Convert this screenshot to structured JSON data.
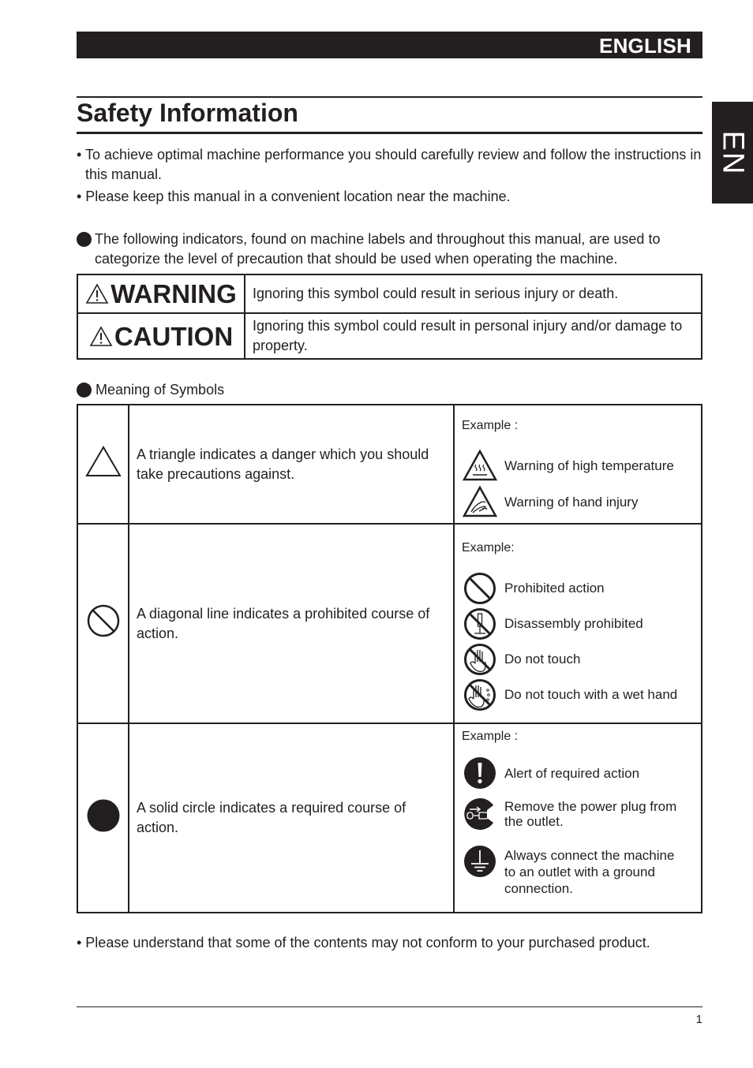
{
  "header": {
    "language_banner": "ENGLISH",
    "side_tab": "EN"
  },
  "page_title": "Safety Information",
  "intro_bullets": [
    "• To achieve optimal machine performance you should carefully review and follow the instructions in this manual.",
    "• Please keep this manual in a convenient location near the machine."
  ],
  "indicator_note": "The following indicators, found on machine labels and throughout this manual, are used to categorize the level of precaution that should be used when operating the machine.",
  "levels": [
    {
      "label": "WARNING",
      "icon": "warning-triangle-icon",
      "description": "Ignoring this symbol could result in serious injury or death."
    },
    {
      "label": "CAUTION",
      "icon": "warning-triangle-icon",
      "description": "Ignoring this symbol could result in personal injury and/or damage to property."
    }
  ],
  "symbols_heading": "Meaning of Symbols",
  "symbols": [
    {
      "symbol_icon": "triangle-icon",
      "meaning": "A triangle indicates a danger which you should take precautions against.",
      "example_title": "Example :",
      "examples": [
        {
          "icon": "high-temperature-warning-icon",
          "text": "Warning of high temperature"
        },
        {
          "icon": "hand-injury-warning-icon",
          "text": "Warning of hand injury"
        }
      ]
    },
    {
      "symbol_icon": "prohibition-circle-icon",
      "meaning": "A diagonal line indicates a prohibited course of action.",
      "example_title": "Example:",
      "examples": [
        {
          "icon": "prohibited-action-icon",
          "text": "Prohibited action"
        },
        {
          "icon": "disassembly-prohibited-icon",
          "text": "Disassembly prohibited"
        },
        {
          "icon": "do-not-touch-icon",
          "text": "Do not touch"
        },
        {
          "icon": "do-not-touch-wet-hand-icon",
          "text": "Do not touch with a wet hand"
        }
      ]
    },
    {
      "symbol_icon": "solid-circle-icon",
      "meaning": "A solid circle indicates a required course of action.",
      "example_title": "Example :",
      "examples": [
        {
          "icon": "required-action-alert-icon",
          "text": "Alert of required action"
        },
        {
          "icon": "remove-power-plug-icon",
          "text": "Remove the power plug from\nthe outlet."
        },
        {
          "icon": "ground-connection-icon",
          "text": "Always connect the machine\nto an outlet with a ground\nconnection."
        }
      ]
    }
  ],
  "footer_note": "• Please understand that some of the contents may not conform to your purchased product.",
  "page_number": "1"
}
